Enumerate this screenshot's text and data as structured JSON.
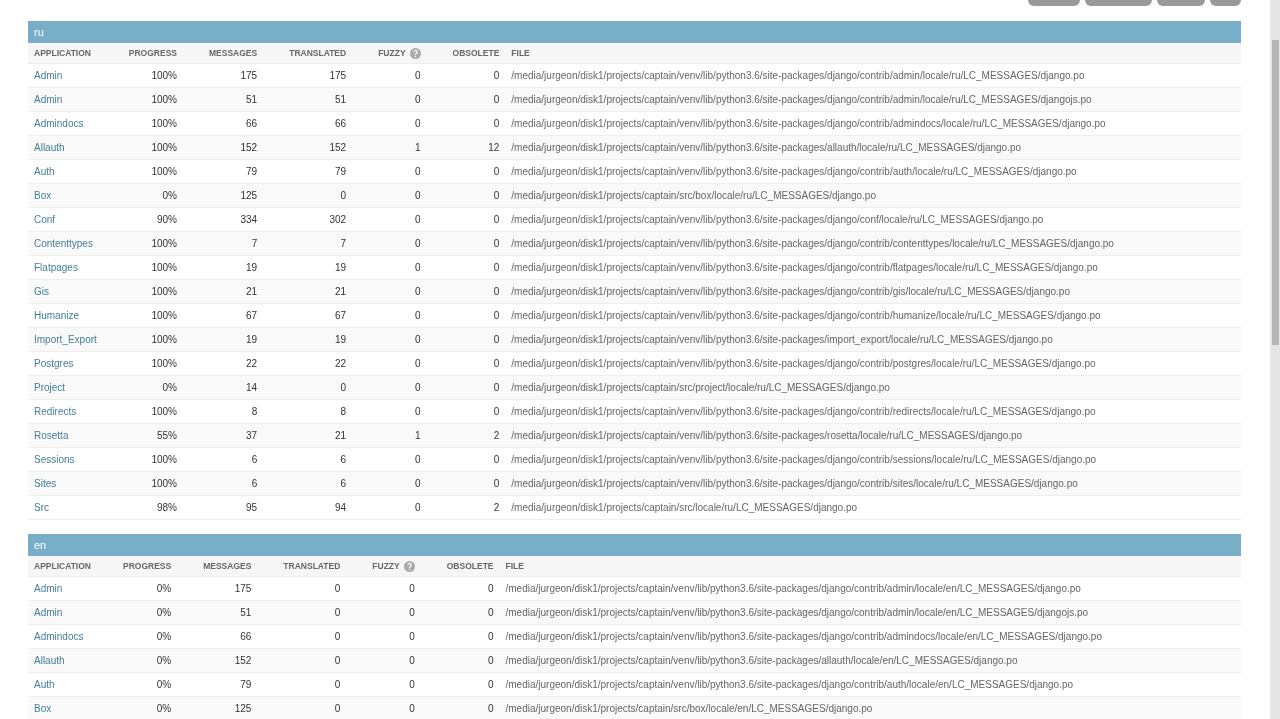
{
  "sections": [
    {
      "language": "ru",
      "columns": [
        "APPLICATION",
        "PROGRESS",
        "MESSAGES",
        "TRANSLATED",
        "FUZZY",
        "OBSOLETE",
        "FILE"
      ],
      "rows": [
        {
          "application": "Admin",
          "progress": "100%",
          "messages": "175",
          "translated": "175",
          "fuzzy": "0",
          "obsolete": "0",
          "file": "/media/jurgeon/disk1/projects/captain/venv/lib/python3.6/site-packages/django/contrib/admin/locale/ru/LC_MESSAGES/django.po"
        },
        {
          "application": "Admin",
          "progress": "100%",
          "messages": "51",
          "translated": "51",
          "fuzzy": "0",
          "obsolete": "0",
          "file": "/media/jurgeon/disk1/projects/captain/venv/lib/python3.6/site-packages/django/contrib/admin/locale/ru/LC_MESSAGES/djangojs.po"
        },
        {
          "application": "Admindocs",
          "progress": "100%",
          "messages": "66",
          "translated": "66",
          "fuzzy": "0",
          "obsolete": "0",
          "file": "/media/jurgeon/disk1/projects/captain/venv/lib/python3.6/site-packages/django/contrib/admindocs/locale/ru/LC_MESSAGES/django.po"
        },
        {
          "application": "Allauth",
          "progress": "100%",
          "messages": "152",
          "translated": "152",
          "fuzzy": "1",
          "obsolete": "12",
          "file": "/media/jurgeon/disk1/projects/captain/venv/lib/python3.6/site-packages/allauth/locale/ru/LC_MESSAGES/django.po"
        },
        {
          "application": "Auth",
          "progress": "100%",
          "messages": "79",
          "translated": "79",
          "fuzzy": "0",
          "obsolete": "0",
          "file": "/media/jurgeon/disk1/projects/captain/venv/lib/python3.6/site-packages/django/contrib/auth/locale/ru/LC_MESSAGES/django.po"
        },
        {
          "application": "Box",
          "progress": "0%",
          "messages": "125",
          "translated": "0",
          "fuzzy": "0",
          "obsolete": "0",
          "file": "/media/jurgeon/disk1/projects/captain/src/box/locale/ru/LC_MESSAGES/django.po"
        },
        {
          "application": "Conf",
          "progress": "90%",
          "messages": "334",
          "translated": "302",
          "fuzzy": "0",
          "obsolete": "0",
          "file": "/media/jurgeon/disk1/projects/captain/venv/lib/python3.6/site-packages/django/conf/locale/ru/LC_MESSAGES/django.po"
        },
        {
          "application": "Contenttypes",
          "progress": "100%",
          "messages": "7",
          "translated": "7",
          "fuzzy": "0",
          "obsolete": "0",
          "file": "/media/jurgeon/disk1/projects/captain/venv/lib/python3.6/site-packages/django/contrib/contenttypes/locale/ru/LC_MESSAGES/django.po"
        },
        {
          "application": "Flatpages",
          "progress": "100%",
          "messages": "19",
          "translated": "19",
          "fuzzy": "0",
          "obsolete": "0",
          "file": "/media/jurgeon/disk1/projects/captain/venv/lib/python3.6/site-packages/django/contrib/flatpages/locale/ru/LC_MESSAGES/django.po"
        },
        {
          "application": "Gis",
          "progress": "100%",
          "messages": "21",
          "translated": "21",
          "fuzzy": "0",
          "obsolete": "0",
          "file": "/media/jurgeon/disk1/projects/captain/venv/lib/python3.6/site-packages/django/contrib/gis/locale/ru/LC_MESSAGES/django.po"
        },
        {
          "application": "Humanize",
          "progress": "100%",
          "messages": "67",
          "translated": "67",
          "fuzzy": "0",
          "obsolete": "0",
          "file": "/media/jurgeon/disk1/projects/captain/venv/lib/python3.6/site-packages/django/contrib/humanize/locale/ru/LC_MESSAGES/django.po"
        },
        {
          "application": "Import_Export",
          "progress": "100%",
          "messages": "19",
          "translated": "19",
          "fuzzy": "0",
          "obsolete": "0",
          "file": "/media/jurgeon/disk1/projects/captain/venv/lib/python3.6/site-packages/import_export/locale/ru/LC_MESSAGES/django.po"
        },
        {
          "application": "Postgres",
          "progress": "100%",
          "messages": "22",
          "translated": "22",
          "fuzzy": "0",
          "obsolete": "0",
          "file": "/media/jurgeon/disk1/projects/captain/venv/lib/python3.6/site-packages/django/contrib/postgres/locale/ru/LC_MESSAGES/django.po"
        },
        {
          "application": "Project",
          "progress": "0%",
          "messages": "14",
          "translated": "0",
          "fuzzy": "0",
          "obsolete": "0",
          "file": "/media/jurgeon/disk1/projects/captain/src/project/locale/ru/LC_MESSAGES/django.po"
        },
        {
          "application": "Redirects",
          "progress": "100%",
          "messages": "8",
          "translated": "8",
          "fuzzy": "0",
          "obsolete": "0",
          "file": "/media/jurgeon/disk1/projects/captain/venv/lib/python3.6/site-packages/django/contrib/redirects/locale/ru/LC_MESSAGES/django.po"
        },
        {
          "application": "Rosetta",
          "progress": "55%",
          "messages": "37",
          "translated": "21",
          "fuzzy": "1",
          "obsolete": "2",
          "file": "/media/jurgeon/disk1/projects/captain/venv/lib/python3.6/site-packages/rosetta/locale/ru/LC_MESSAGES/django.po"
        },
        {
          "application": "Sessions",
          "progress": "100%",
          "messages": "6",
          "translated": "6",
          "fuzzy": "0",
          "obsolete": "0",
          "file": "/media/jurgeon/disk1/projects/captain/venv/lib/python3.6/site-packages/django/contrib/sessions/locale/ru/LC_MESSAGES/django.po"
        },
        {
          "application": "Sites",
          "progress": "100%",
          "messages": "6",
          "translated": "6",
          "fuzzy": "0",
          "obsolete": "0",
          "file": "/media/jurgeon/disk1/projects/captain/venv/lib/python3.6/site-packages/django/contrib/sites/locale/ru/LC_MESSAGES/django.po"
        },
        {
          "application": "Src",
          "progress": "98%",
          "messages": "95",
          "translated": "94",
          "fuzzy": "0",
          "obsolete": "2",
          "file": "/media/jurgeon/disk1/projects/captain/src/locale/ru/LC_MESSAGES/django.po"
        }
      ]
    },
    {
      "language": "en",
      "columns": [
        "APPLICATION",
        "PROGRESS",
        "MESSAGES",
        "TRANSLATED",
        "FUZZY",
        "OBSOLETE",
        "FILE"
      ],
      "rows": [
        {
          "application": "Admin",
          "progress": "0%",
          "messages": "175",
          "translated": "0",
          "fuzzy": "0",
          "obsolete": "0",
          "file": "/media/jurgeon/disk1/projects/captain/venv/lib/python3.6/site-packages/django/contrib/admin/locale/en/LC_MESSAGES/django.po"
        },
        {
          "application": "Admin",
          "progress": "0%",
          "messages": "51",
          "translated": "0",
          "fuzzy": "0",
          "obsolete": "0",
          "file": "/media/jurgeon/disk1/projects/captain/venv/lib/python3.6/site-packages/django/contrib/admin/locale/en/LC_MESSAGES/djangojs.po"
        },
        {
          "application": "Admindocs",
          "progress": "0%",
          "messages": "66",
          "translated": "0",
          "fuzzy": "0",
          "obsolete": "0",
          "file": "/media/jurgeon/disk1/projects/captain/venv/lib/python3.6/site-packages/django/contrib/admindocs/locale/en/LC_MESSAGES/django.po"
        },
        {
          "application": "Allauth",
          "progress": "0%",
          "messages": "152",
          "translated": "0",
          "fuzzy": "0",
          "obsolete": "0",
          "file": "/media/jurgeon/disk1/projects/captain/venv/lib/python3.6/site-packages/allauth/locale/en/LC_MESSAGES/django.po"
        },
        {
          "application": "Auth",
          "progress": "0%",
          "messages": "79",
          "translated": "0",
          "fuzzy": "0",
          "obsolete": "0",
          "file": "/media/jurgeon/disk1/projects/captain/venv/lib/python3.6/site-packages/django/contrib/auth/locale/en/LC_MESSAGES/django.po"
        },
        {
          "application": "Box",
          "progress": "0%",
          "messages": "125",
          "translated": "0",
          "fuzzy": "0",
          "obsolete": "0",
          "file": "/media/jurgeon/disk1/projects/captain/src/box/locale/en/LC_MESSAGES/django.po"
        }
      ]
    }
  ]
}
